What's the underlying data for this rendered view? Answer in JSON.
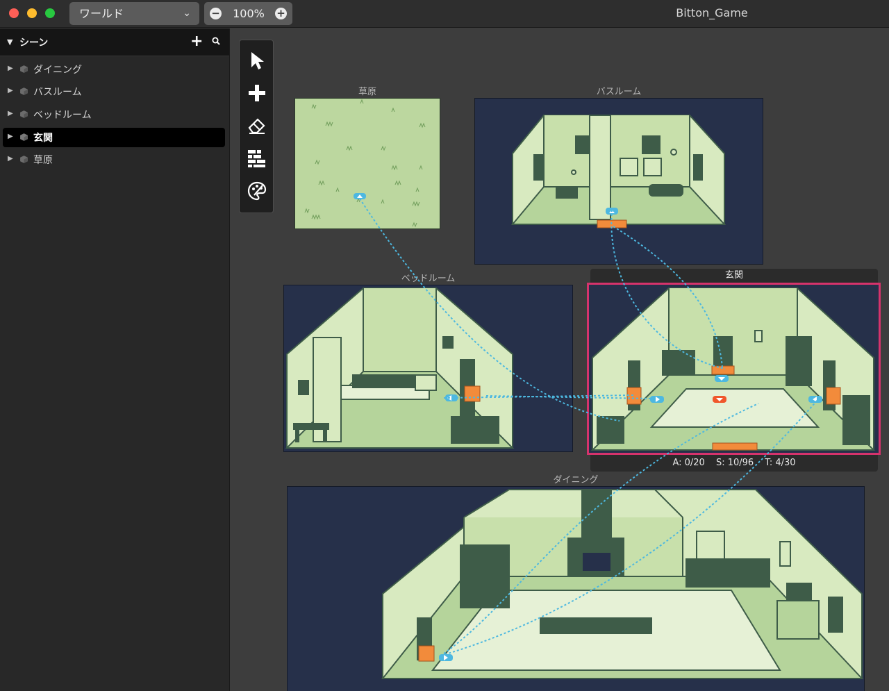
{
  "window": {
    "title": "Bitton_Game",
    "world_select": "ワールド",
    "zoom": "100%"
  },
  "sidebar": {
    "title": "シーン",
    "items": [
      {
        "label": "ダイニング",
        "active": false
      },
      {
        "label": "バスルーム",
        "active": false
      },
      {
        "label": "ベッドルーム",
        "active": false
      },
      {
        "label": "玄関",
        "active": true
      },
      {
        "label": "草原",
        "active": false
      }
    ]
  },
  "tools": [
    "pointer-icon",
    "add-icon",
    "eraser-icon",
    "wall-icon",
    "palette-icon"
  ],
  "scenes": {
    "grassland": {
      "label": "草原"
    },
    "bathroom": {
      "label": "バスルーム"
    },
    "bedroom": {
      "label": "ベッドルーム"
    },
    "entrance": {
      "label": "玄関",
      "stats": {
        "a": "A: 0/20",
        "s": "S: 10/96",
        "t": "T: 4/30"
      }
    },
    "dining": {
      "label": "ダイニング"
    }
  },
  "colors": {
    "room_light": "#d8eac0",
    "room_mid": "#a9cf91",
    "room_dark": "#3e5c48",
    "backdrop": "#26304a",
    "grass": "#bcd79f",
    "link": "#4db8e0",
    "exit": "#f28b3b",
    "selection": "#d6336c"
  }
}
